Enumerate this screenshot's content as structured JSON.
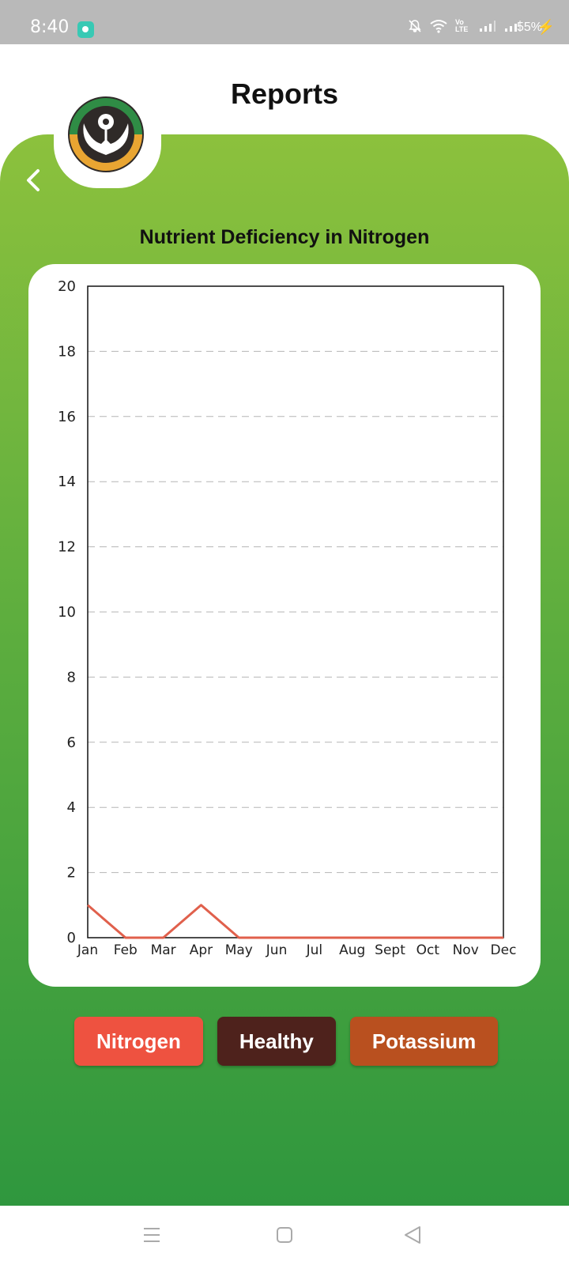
{
  "status_bar": {
    "time": "8:40",
    "network_badge": "Vo LTE",
    "battery": "55%",
    "icons": [
      "mute-icon",
      "wifi-icon",
      "volte-icon",
      "signal-icon",
      "signal-icon",
      "battery-charging-icon"
    ]
  },
  "header": {
    "title": "Reports"
  },
  "colors": {
    "panel_top": "#8cc13d",
    "panel_bottom": "#2f973e",
    "nitrogen": "#ee5240",
    "healthy": "#4e221c",
    "potassium": "#b9501f",
    "line": "#e0604c"
  },
  "chart_data": {
    "type": "line",
    "title": "Nutrient Deficiency in Nitrogen",
    "categories": [
      "Jan",
      "Feb",
      "Mar",
      "Apr",
      "May",
      "Jun",
      "Jul",
      "Aug",
      "Sept",
      "Oct",
      "Nov",
      "Dec"
    ],
    "series": [
      {
        "values": [
          1,
          0,
          0,
          1,
          0,
          0,
          0,
          0,
          0,
          0,
          0,
          0
        ]
      }
    ],
    "ylim": [
      0,
      20
    ],
    "y_ticks": [
      0,
      2,
      4,
      6,
      8,
      10,
      12,
      14,
      16,
      18,
      20
    ],
    "grid": "horizontal-dashed",
    "xlabel": "",
    "ylabel": ""
  },
  "legend_buttons": [
    {
      "label": "Nitrogen"
    },
    {
      "label": "Healthy"
    },
    {
      "label": "Potassium"
    }
  ]
}
